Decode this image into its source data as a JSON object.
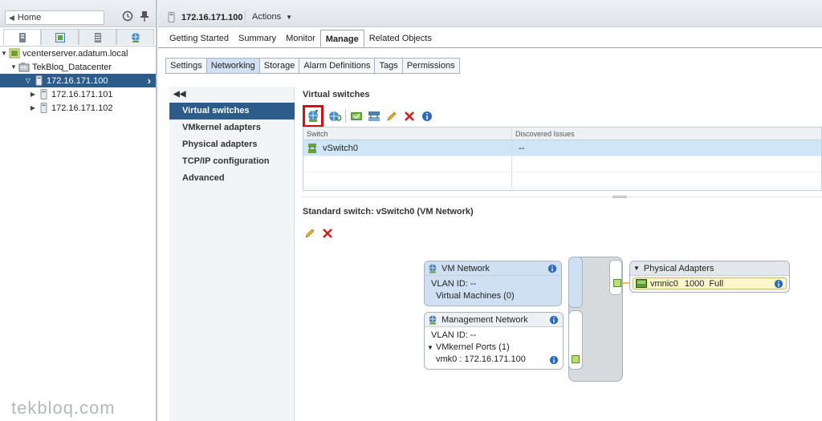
{
  "nav": {
    "home_label": "Home",
    "tree": [
      {
        "label": "vcenterserver.adatum.local",
        "icon": "vcenter-icon"
      },
      {
        "label": "TekBloq_Datacenter",
        "icon": "datacenter-icon"
      },
      {
        "label": "172.16.171.100",
        "icon": "host-icon",
        "selected": true
      },
      {
        "label": "172.16.171.101",
        "icon": "host-icon"
      },
      {
        "label": "172.16.171.102",
        "icon": "host-icon"
      }
    ]
  },
  "header": {
    "host": "172.16.171.100",
    "actions_label": "Actions"
  },
  "tabs": {
    "top": [
      "Getting Started",
      "Summary",
      "Monitor",
      "Manage",
      "Related Objects"
    ],
    "active_top": "Manage",
    "sub": [
      "Settings",
      "Networking",
      "Storage",
      "Alarm Definitions",
      "Tags",
      "Permissions"
    ],
    "active_sub": "Networking"
  },
  "side_nav": {
    "items": [
      "Virtual switches",
      "VMkernel adapters",
      "Physical adapters",
      "TCP/IP configuration",
      "Advanced"
    ],
    "active": "Virtual switches"
  },
  "virtual_switches": {
    "title": "Virtual switches",
    "columns": [
      "Switch",
      "Discovered Issues"
    ],
    "rows": [
      {
        "switch": "vSwitch0",
        "issues": "--"
      }
    ]
  },
  "standard_switch": {
    "title": "Standard switch: vSwitch0 (VM Network)",
    "vm_network": {
      "name": "VM Network",
      "vlan": "VLAN ID: --",
      "vms": "Virtual Machines (0)"
    },
    "mgmt_network": {
      "name": "Management Network",
      "vlan": "VLAN ID: --",
      "ports": "VMkernel Ports (1)",
      "vmk": "vmk0 : 172.16.171.100"
    },
    "physical_adapters": {
      "title": "Physical Adapters",
      "adapter": "vmnic0",
      "speed": "1000",
      "duplex": "Full"
    }
  },
  "colors": {
    "accent": "#2e5c8a",
    "selected_row": "#cfe6f8",
    "highlight": "#d01010"
  },
  "watermark": "tekbloq.com"
}
